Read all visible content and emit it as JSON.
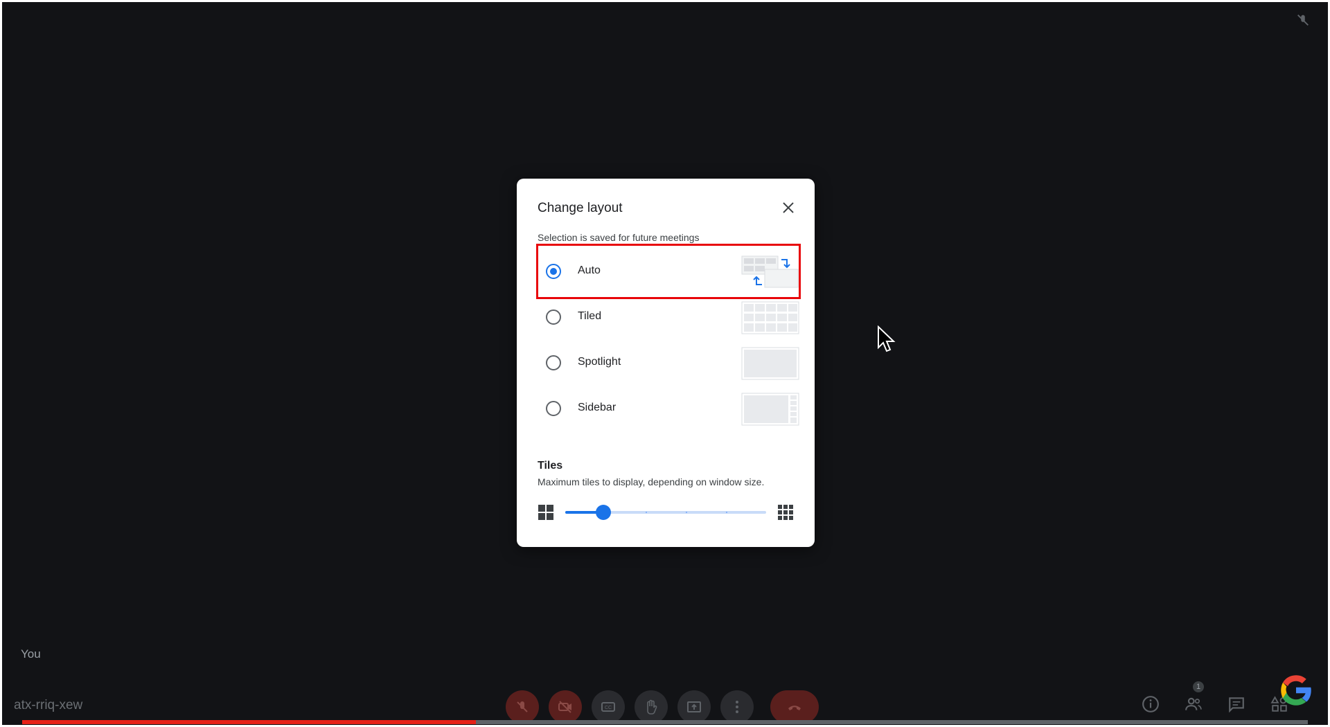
{
  "dialog": {
    "title": "Change layout",
    "subtitle": "Selection is saved for future meetings",
    "options": [
      {
        "label": "Auto",
        "selected": true
      },
      {
        "label": "Tiled",
        "selected": false
      },
      {
        "label": "Spotlight",
        "selected": false
      },
      {
        "label": "Sidebar",
        "selected": false
      }
    ],
    "tiles": {
      "title": "Tiles",
      "description": "Maximum tiles to display, depending on window size.",
      "slider_fraction": 0.19
    }
  },
  "video": {
    "self_label": "You",
    "meeting_code": "atx-rriq-xew",
    "playback_fraction": 0.353
  },
  "people_count": "1",
  "colors": {
    "accent": "#1a73e8",
    "highlight": "#e8060a",
    "background": "#121316",
    "progress": "#e62117"
  },
  "icons": [
    "close-icon",
    "mic-off-icon",
    "camera-off-icon",
    "captions-icon",
    "raise-hand-icon",
    "present-icon",
    "more-icon",
    "end-call-icon",
    "info-icon",
    "people-icon",
    "chat-icon",
    "activities-icon",
    "google-logo",
    "grid-small-icon",
    "grid-large-icon"
  ]
}
